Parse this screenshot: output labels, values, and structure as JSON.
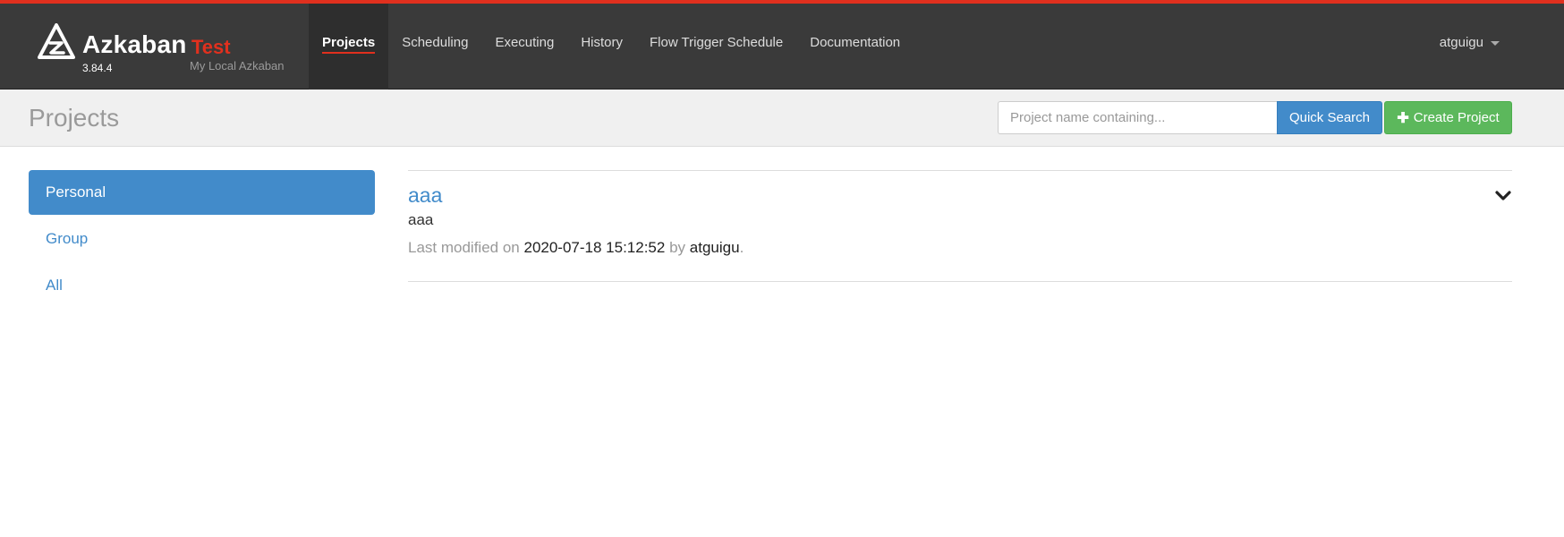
{
  "brand": {
    "name": "Azkaban",
    "env": "Test",
    "version": "3.84.4",
    "subtitle": "My Local Azkaban"
  },
  "nav": {
    "items": [
      {
        "label": "Projects",
        "active": true
      },
      {
        "label": "Scheduling",
        "active": false
      },
      {
        "label": "Executing",
        "active": false
      },
      {
        "label": "History",
        "active": false
      },
      {
        "label": "Flow Trigger Schedule",
        "active": false
      },
      {
        "label": "Documentation",
        "active": false
      }
    ],
    "user": "atguigu"
  },
  "header": {
    "title": "Projects",
    "search_placeholder": "Project name containing...",
    "search_button": "Quick Search",
    "create_button": "Create Project"
  },
  "sidebar": {
    "items": [
      {
        "label": "Personal",
        "active": true
      },
      {
        "label": "Group",
        "active": false
      },
      {
        "label": "All",
        "active": false
      }
    ]
  },
  "projects": [
    {
      "name": "aaa",
      "description": "aaa",
      "modified_prefix": "Last modified on",
      "modified_time": "2020-07-18 15:12:52",
      "by_text": "by",
      "user": "atguigu",
      "end": "."
    }
  ],
  "colors": {
    "accent_red": "#e0301e",
    "primary_blue": "#428bca",
    "success_green": "#5cb85c",
    "navbar_bg": "#3a3a3a"
  },
  "icons": {
    "logo": "azkaban-logo-icon",
    "user_caret": "caret-down-icon",
    "create": "plus-icon",
    "expand": "chevron-down-icon"
  }
}
